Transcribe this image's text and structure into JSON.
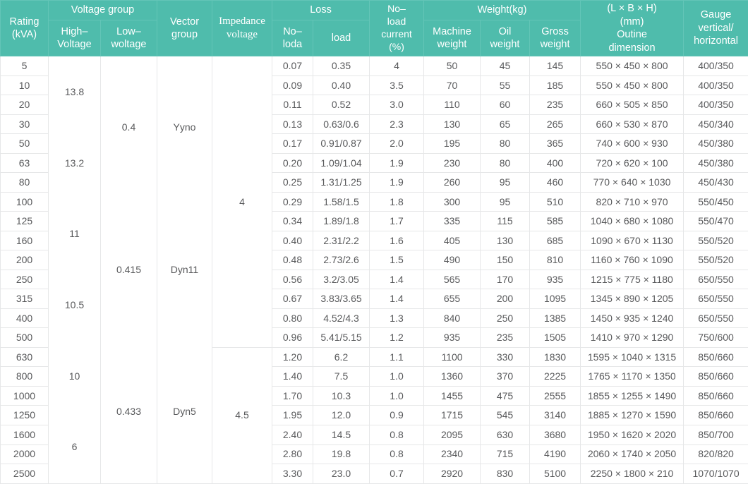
{
  "theme": {
    "header_bg": "#4fbcac",
    "header_text": "#ffffff",
    "body_text": "#58595b",
    "grid_line": "#e6e7e8"
  },
  "header": {
    "rating": "Rating\n(kVA)",
    "rating_line1": "Rating",
    "rating_line2": "(kVA)",
    "voltage_group": "Voltage group",
    "high_voltage": "High–\nVoltage",
    "high_voltage_line1": "High–",
    "high_voltage_line2": "Voltage",
    "low_voltage_line1": "Low–",
    "low_voltage_line2": "woltage",
    "vector_group_line1": "Vector",
    "vector_group_line2": "group",
    "impedance_line1": "Impedance",
    "impedance_line2": "voltage",
    "loss": "Loss",
    "loss_noload_line1": "No–",
    "loss_noload_line2": "loda",
    "loss_load": "load",
    "noload_current_line1": "No–",
    "noload_current_line2": "load",
    "noload_current_line3": "current",
    "noload_current_line4": "(%)",
    "weight": "Weight(kg)",
    "machine_weight_line1": "Machine",
    "machine_weight_line2": "weight",
    "oil_weight_line1": "Oil",
    "oil_weight_line2": "weight",
    "gross_weight_line1": "Gross",
    "gross_weight_line2": "weight",
    "dimension_line1": "(L × B × H)",
    "dimension_line2": "(mm)",
    "dimension_line3": "Outine",
    "dimension_line4": "dimension",
    "gauge_line1": "Gauge",
    "gauge_line2": "vertical/",
    "gauge_line3": "horizontal"
  },
  "merged": {
    "high_voltage_values": [
      "13.8",
      "13.2",
      "11",
      "10.5",
      "10",
      "6"
    ],
    "low_voltage_values": [
      "0.4",
      "0.415",
      "0.433"
    ],
    "vector_group_values": [
      "Yyno",
      "Dyn11",
      "Dyn5"
    ],
    "impedance_upper": "4",
    "impedance_lower": "4.5"
  },
  "table_data": {
    "type": "table",
    "columns": [
      "Rating (kVA)",
      "Loss No-load",
      "Loss load",
      "No-load current (%)",
      "Machine weight",
      "Oil weight",
      "Gross weight",
      "Outline dimension (L × B × H) mm",
      "Gauge vertical/horizontal"
    ],
    "rows": [
      {
        "rating": "5",
        "loss_noload": "0.07",
        "loss_load": "0.35",
        "noload_current": "4",
        "machine_weight": "50",
        "oil_weight": "45",
        "gross_weight": "145",
        "dimension": "550 × 450 × 800",
        "gauge": "400/350"
      },
      {
        "rating": "10",
        "loss_noload": "0.09",
        "loss_load": "0.40",
        "noload_current": "3.5",
        "machine_weight": "70",
        "oil_weight": "55",
        "gross_weight": "185",
        "dimension": "550 × 450 × 800",
        "gauge": "400/350"
      },
      {
        "rating": "20",
        "loss_noload": "0.11",
        "loss_load": "0.52",
        "noload_current": "3.0",
        "machine_weight": "110",
        "oil_weight": "60",
        "gross_weight": "235",
        "dimension": "660 × 505 × 850",
        "gauge": "400/350"
      },
      {
        "rating": "30",
        "loss_noload": "0.13",
        "loss_load": "0.63/0.6",
        "noload_current": "2.3",
        "machine_weight": "130",
        "oil_weight": "65",
        "gross_weight": "265",
        "dimension": "660 × 530 × 870",
        "gauge": "450/340"
      },
      {
        "rating": "50",
        "loss_noload": "0.17",
        "loss_load": "0.91/0.87",
        "noload_current": "2.0",
        "machine_weight": "195",
        "oil_weight": "80",
        "gross_weight": "365",
        "dimension": "740 × 600 × 930",
        "gauge": "450/380"
      },
      {
        "rating": "63",
        "loss_noload": "0.20",
        "loss_load": "1.09/1.04",
        "noload_current": "1.9",
        "machine_weight": "230",
        "oil_weight": "80",
        "gross_weight": "400",
        "dimension": "720 × 620 × 100",
        "gauge": "450/380"
      },
      {
        "rating": "80",
        "loss_noload": "0.25",
        "loss_load": "1.31/1.25",
        "noload_current": "1.9",
        "machine_weight": "260",
        "oil_weight": "95",
        "gross_weight": "460",
        "dimension": "770 × 640 × 1030",
        "gauge": "450/430"
      },
      {
        "rating": "100",
        "loss_noload": "0.29",
        "loss_load": "1.58/1.5",
        "noload_current": "1.8",
        "machine_weight": "300",
        "oil_weight": "95",
        "gross_weight": "510",
        "dimension": "820 × 710 × 970",
        "gauge": "550/450"
      },
      {
        "rating": "125",
        "loss_noload": "0.34",
        "loss_load": "1.89/1.8",
        "noload_current": "1.7",
        "machine_weight": "335",
        "oil_weight": "115",
        "gross_weight": "585",
        "dimension": "1040 × 680 × 1080",
        "gauge": "550/470"
      },
      {
        "rating": "160",
        "loss_noload": "0.40",
        "loss_load": "2.31/2.2",
        "noload_current": "1.6",
        "machine_weight": "405",
        "oil_weight": "130",
        "gross_weight": "685",
        "dimension": "1090 × 670 × 1130",
        "gauge": "550/520"
      },
      {
        "rating": "200",
        "loss_noload": "0.48",
        "loss_load": "2.73/2.6",
        "noload_current": "1.5",
        "machine_weight": "490",
        "oil_weight": "150",
        "gross_weight": "810",
        "dimension": "1160 × 760 × 1090",
        "gauge": "550/520"
      },
      {
        "rating": "250",
        "loss_noload": "0.56",
        "loss_load": "3.2/3.05",
        "noload_current": "1.4",
        "machine_weight": "565",
        "oil_weight": "170",
        "gross_weight": "935",
        "dimension": "1215 × 775 × 1180",
        "gauge": "650/550"
      },
      {
        "rating": "315",
        "loss_noload": "0.67",
        "loss_load": "3.83/3.65",
        "noload_current": "1.4",
        "machine_weight": "655",
        "oil_weight": "200",
        "gross_weight": "1095",
        "dimension": "1345 × 890 × 1205",
        "gauge": "650/550"
      },
      {
        "rating": "400",
        "loss_noload": "0.80",
        "loss_load": "4.52/4.3",
        "noload_current": "1.3",
        "machine_weight": "840",
        "oil_weight": "250",
        "gross_weight": "1385",
        "dimension": "1450 × 935 × 1240",
        "gauge": "650/550"
      },
      {
        "rating": "500",
        "loss_noload": "0.96",
        "loss_load": "5.41/5.15",
        "noload_current": "1.2",
        "machine_weight": "935",
        "oil_weight": "235",
        "gross_weight": "1505",
        "dimension": "1410 × 970 × 1290",
        "gauge": "750/600"
      },
      {
        "rating": "630",
        "loss_noload": "1.20",
        "loss_load": "6.2",
        "noload_current": "1.1",
        "machine_weight": "1100",
        "oil_weight": "330",
        "gross_weight": "1830",
        "dimension": "1595 × 1040 × 1315",
        "gauge": "850/660"
      },
      {
        "rating": "800",
        "loss_noload": "1.40",
        "loss_load": "7.5",
        "noload_current": "1.0",
        "machine_weight": "1360",
        "oil_weight": "370",
        "gross_weight": "2225",
        "dimension": "1765 × 1170 × 1350",
        "gauge": "850/660"
      },
      {
        "rating": "1000",
        "loss_noload": "1.70",
        "loss_load": "10.3",
        "noload_current": "1.0",
        "machine_weight": "1455",
        "oil_weight": "475",
        "gross_weight": "2555",
        "dimension": "1855 × 1255 × 1490",
        "gauge": "850/660"
      },
      {
        "rating": "1250",
        "loss_noload": "1.95",
        "loss_load": "12.0",
        "noload_current": "0.9",
        "machine_weight": "1715",
        "oil_weight": "545",
        "gross_weight": "3140",
        "dimension": "1885 × 1270 × 1590",
        "gauge": "850/660"
      },
      {
        "rating": "1600",
        "loss_noload": "2.40",
        "loss_load": "14.5",
        "noload_current": "0.8",
        "machine_weight": "2095",
        "oil_weight": "630",
        "gross_weight": "3680",
        "dimension": "1950 × 1620 × 2020",
        "gauge": "850/700"
      },
      {
        "rating": "2000",
        "loss_noload": "2.80",
        "loss_load": "19.8",
        "noload_current": "0.8",
        "machine_weight": "2340",
        "oil_weight": "715",
        "gross_weight": "4190",
        "dimension": "2060 × 1740 × 2050",
        "gauge": "820/820"
      },
      {
        "rating": "2500",
        "loss_noload": "3.30",
        "loss_load": "23.0",
        "noload_current": "0.7",
        "machine_weight": "2920",
        "oil_weight": "830",
        "gross_weight": "5100",
        "dimension": "2250 × 1800 × 210",
        "gauge": "1070/1070"
      }
    ]
  }
}
